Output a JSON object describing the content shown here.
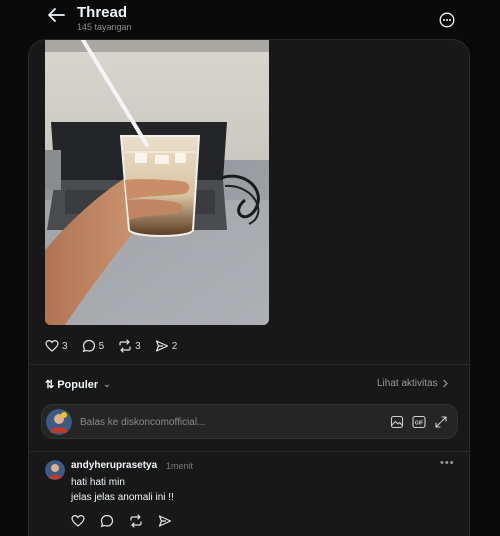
{
  "header": {
    "title": "Thread",
    "views": "145 tayangan"
  },
  "post": {
    "photo_alt": "Hand holding iced coffee glass in front of a laptop",
    "actions": {
      "likes": "3",
      "comments": "5",
      "reposts": "3",
      "shares": "2"
    }
  },
  "replies": {
    "sort_label": "Populer",
    "activity_label": "Lihat aktivitas",
    "input_placeholder": "Balas ke diskoncomofficial..."
  },
  "comment": {
    "username": "andyheruprasetya",
    "time": "1menit",
    "lines": [
      "hati hati min",
      "jelas jelas anomali ini !!"
    ]
  },
  "colors": {
    "background": "#0a0a0a",
    "card": "#181818",
    "text": "#f3f5f7",
    "muted": "#8a8a8a"
  },
  "icons": [
    "back-arrow-icon",
    "more-circle-icon",
    "heart-icon",
    "comment-icon",
    "repost-icon",
    "share-icon",
    "sort-icon",
    "chevron-down-icon",
    "chevron-right-icon",
    "image-icon",
    "gif-icon",
    "expand-icon",
    "more-dots-icon"
  ]
}
